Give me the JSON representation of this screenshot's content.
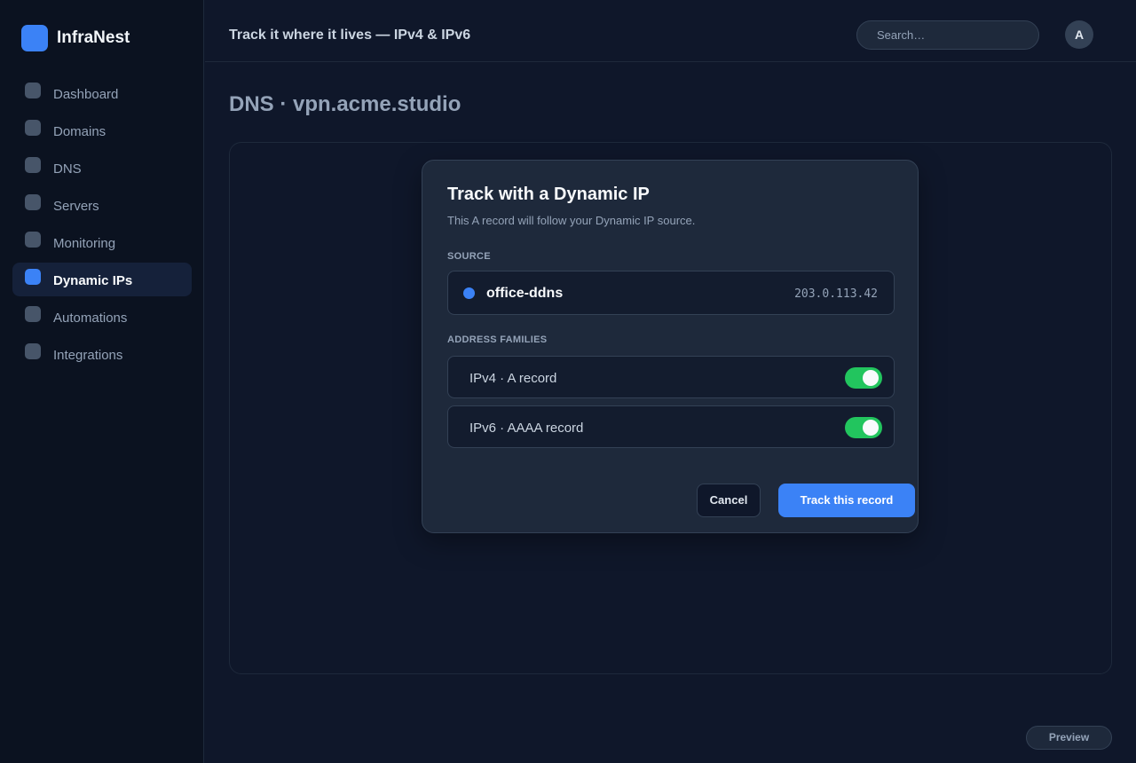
{
  "app": {
    "name": "InfraNest"
  },
  "sidebar": {
    "items": [
      {
        "label": "Dashboard",
        "icon": "dashboard-icon",
        "active": false
      },
      {
        "label": "Domains",
        "icon": "domains-icon",
        "active": false
      },
      {
        "label": "DNS",
        "icon": "dns-icon",
        "active": false
      },
      {
        "label": "Servers",
        "icon": "servers-icon",
        "active": false
      },
      {
        "label": "Monitoring",
        "icon": "monitoring-icon",
        "active": false
      },
      {
        "label": "Dynamic IPs",
        "icon": "dynamic-ips-icon",
        "active": true
      },
      {
        "label": "Automations",
        "icon": "automations-icon",
        "active": false
      },
      {
        "label": "Integrations",
        "icon": "integrations-icon",
        "active": false
      }
    ]
  },
  "topbar": {
    "title": "Track it where it lives — IPv4 & IPv6",
    "search_placeholder": "Search…",
    "avatar_initial": "A"
  },
  "page": {
    "title": "DNS · vpn.acme.studio"
  },
  "modal": {
    "title": "Track with a Dynamic IP",
    "subtitle": "This A record will follow your Dynamic IP source.",
    "source_label": "SOURCE",
    "source": {
      "name": "office-ddns",
      "ip": "203.0.113.42"
    },
    "families_label": "ADDRESS FAMILIES",
    "families": [
      {
        "label": "IPv4 · A record",
        "enabled": true
      },
      {
        "label": "IPv6 · AAAA record",
        "enabled": true
      }
    ],
    "cancel_label": "Cancel",
    "confirm_label": "Track this record"
  },
  "footer": {
    "preview_label": "Preview"
  },
  "colors": {
    "accent": "#3b82f6",
    "toggle_on": "#22c55e",
    "background": "#0f172a",
    "sidebar_bg": "#0b1220",
    "modal_bg": "#1e293b"
  }
}
